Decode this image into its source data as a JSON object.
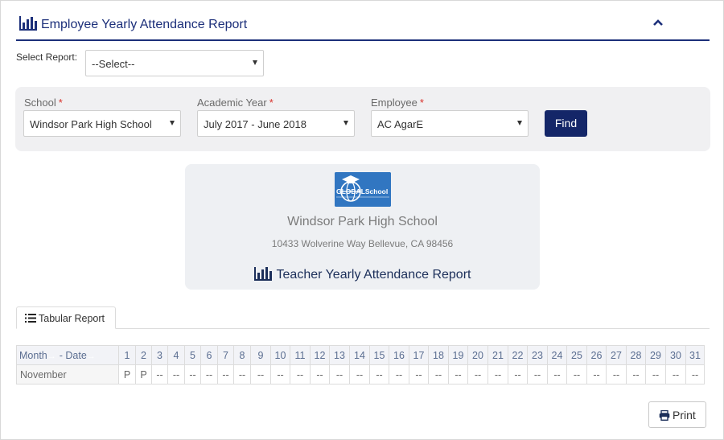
{
  "header": {
    "title": "Employee Yearly Attendance Report",
    "title_icon": "bar-chart-icon",
    "collapse_icon": "chevron-up-icon"
  },
  "select_report": {
    "label": "Select Report:",
    "value": "--Select--"
  },
  "filters": {
    "school": {
      "label": "School",
      "required_mark": "*",
      "value": "Windsor Park High School"
    },
    "academic_year": {
      "label": "Academic Year",
      "required_mark": "*",
      "value": "July 2017 - June 2018"
    },
    "employee": {
      "label": "Employee",
      "required_mark": "*",
      "value": "AC AgarE"
    },
    "find_label": "Find"
  },
  "report_card": {
    "logo_text": "GLOBALSchool",
    "school_name": "Windsor Park High School",
    "address": "10433 Wolverine Way Bellevue, CA 98456",
    "report_title": "Teacher Yearly Attendance Report",
    "report_icon": "bar-chart-icon"
  },
  "tabs": [
    {
      "label": "Tabular Report",
      "icon": "list-icon",
      "active": true
    }
  ],
  "table": {
    "month_header": "Month",
    "date_header": "- Date",
    "sort_arrow": "→",
    "days": [
      "1",
      "2",
      "3",
      "4",
      "5",
      "6",
      "7",
      "8",
      "9",
      "10",
      "11",
      "12",
      "13",
      "14",
      "15",
      "16",
      "17",
      "18",
      "19",
      "20",
      "21",
      "22",
      "23",
      "24",
      "25",
      "26",
      "27",
      "28",
      "29",
      "30",
      "31"
    ],
    "rows": [
      {
        "month": "November",
        "values": [
          "P",
          "P",
          "--",
          "--",
          "--",
          "--",
          "--",
          "--",
          "--",
          "--",
          "--",
          "--",
          "--",
          "--",
          "--",
          "--",
          "--",
          "--",
          "--",
          "--",
          "--",
          "--",
          "--",
          "--",
          "--",
          "--",
          "--",
          "--",
          "--",
          "--",
          "--"
        ]
      }
    ]
  },
  "print_label": "Print",
  "colors": {
    "primary": "#142668",
    "header_text": "#1c2f7a",
    "required": "#d9312b",
    "absent": "#d9312b",
    "logo_bg": "#3176c1"
  }
}
